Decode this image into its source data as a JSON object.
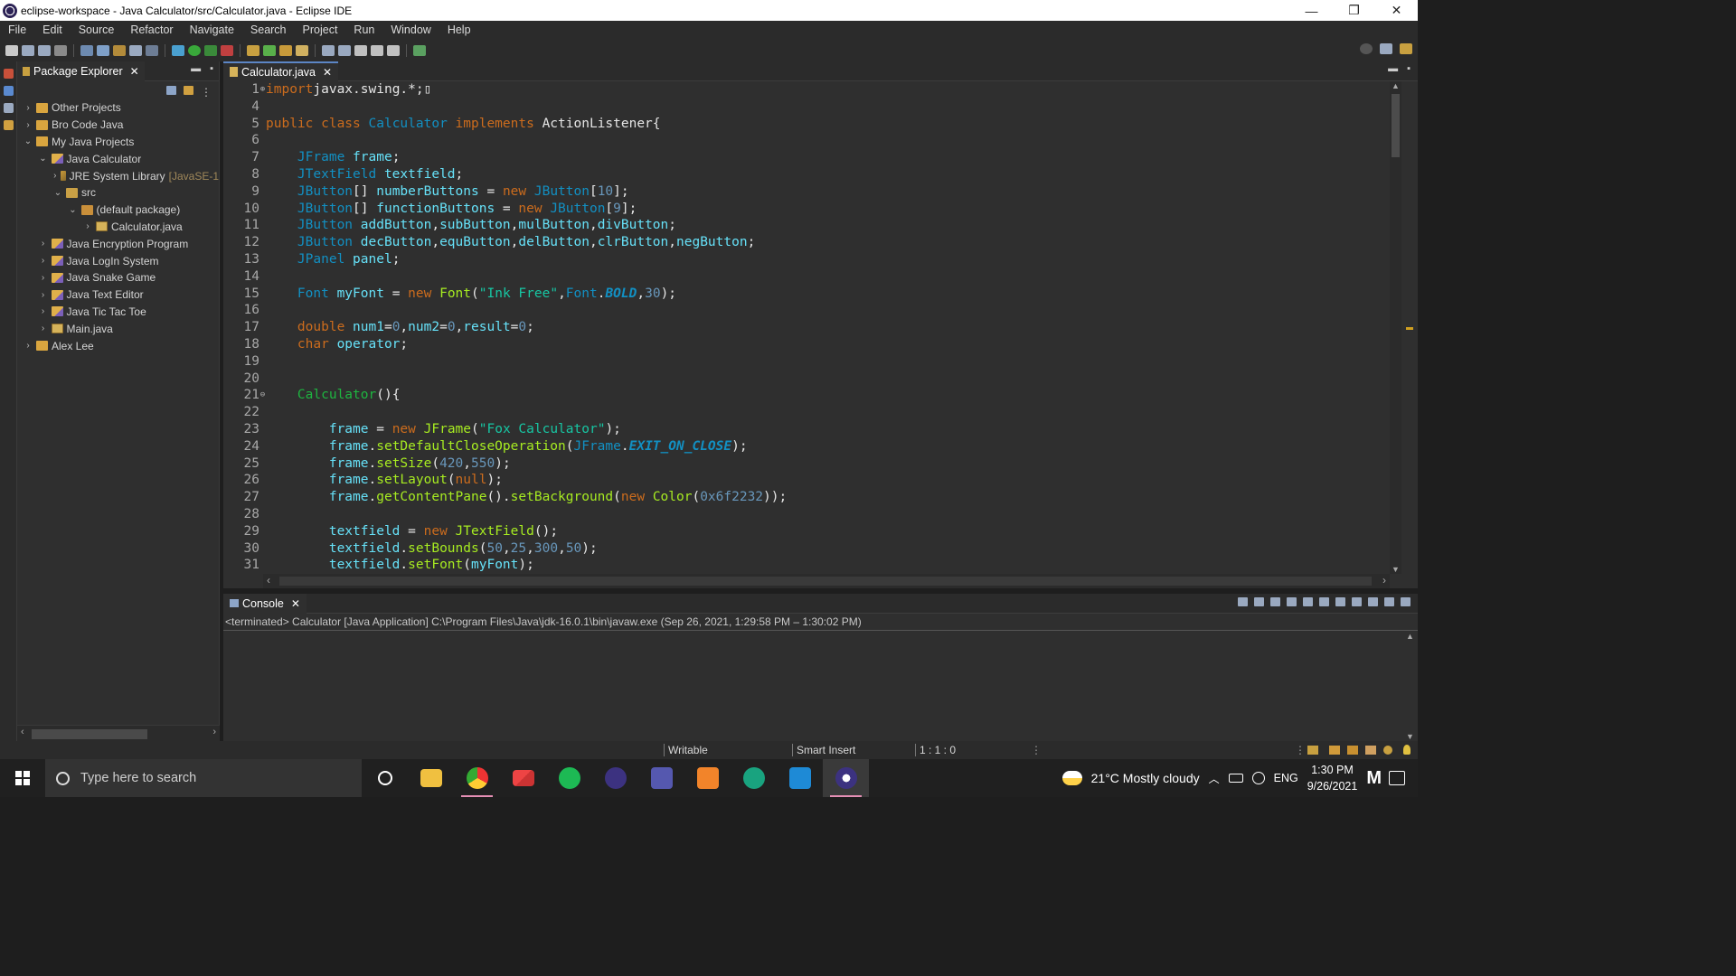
{
  "window": {
    "title": "eclipse-workspace - Java Calculator/src/Calculator.java - Eclipse IDE",
    "controls": [
      "—",
      "❐",
      "✕"
    ]
  },
  "menu": [
    "File",
    "Edit",
    "Source",
    "Refactor",
    "Navigate",
    "Search",
    "Project",
    "Run",
    "Window",
    "Help"
  ],
  "package_explorer": {
    "tab_label": "Package Explorer",
    "tree": [
      {
        "label": "Other Projects",
        "depth": 0,
        "twisty": ">",
        "icon": "folder-icon",
        "decoration": ""
      },
      {
        "label": "Bro Code Java",
        "depth": 0,
        "twisty": ">",
        "icon": "folder-icon",
        "decoration": ""
      },
      {
        "label": "My Java Projects",
        "depth": 0,
        "twisty": "v",
        "icon": "folder-icon",
        "decoration": ""
      },
      {
        "label": "Java Calculator",
        "depth": 1,
        "twisty": "v",
        "icon": "project-icon",
        "decoration": ""
      },
      {
        "label": "JRE System Library",
        "depth": 2,
        "twisty": ">",
        "icon": "library-icon",
        "decoration": "[JavaSE-1"
      },
      {
        "label": "src",
        "depth": 2,
        "twisty": "v",
        "icon": "source-folder-icon",
        "decoration": ""
      },
      {
        "label": "(default package)",
        "depth": 3,
        "twisty": "v",
        "icon": "package-icon",
        "decoration": ""
      },
      {
        "label": "Calculator.java",
        "depth": 4,
        "twisty": ">",
        "icon": "java-file-icon",
        "decoration": ""
      },
      {
        "label": "Java Encryption Program",
        "depth": 1,
        "twisty": ">",
        "icon": "project-icon",
        "decoration": ""
      },
      {
        "label": "Java LogIn System",
        "depth": 1,
        "twisty": ">",
        "icon": "project-icon",
        "decoration": ""
      },
      {
        "label": "Java Snake Game",
        "depth": 1,
        "twisty": ">",
        "icon": "project-icon",
        "decoration": ""
      },
      {
        "label": "Java Text Editor",
        "depth": 1,
        "twisty": ">",
        "icon": "project-icon",
        "decoration": ""
      },
      {
        "label": "Java Tic Tac Toe",
        "depth": 1,
        "twisty": ">",
        "icon": "project-icon",
        "decoration": ""
      },
      {
        "label": "Main.java",
        "depth": 1,
        "twisty": ">",
        "icon": "java-file-icon",
        "decoration": ""
      },
      {
        "label": "Alex Lee",
        "depth": 0,
        "twisty": ">",
        "icon": "folder-icon",
        "decoration": ""
      }
    ]
  },
  "editor": {
    "tab_label": "Calculator.java",
    "lines": [
      {
        "n": "1",
        "fold": "⊕",
        "tokens": [
          [
            "kw",
            "import"
          ],
          [
            "",
            "javax.swing.*;"
          ],
          [
            "",
            "▯"
          ]
        ]
      },
      {
        "n": "4",
        "fold": "",
        "tokens": []
      },
      {
        "n": "5",
        "fold": "",
        "tokens": [
          [
            "kw",
            "public class "
          ],
          [
            "ty",
            "Calculator "
          ],
          [
            "kw",
            "implements "
          ],
          [
            "",
            "ActionListener{"
          ]
        ]
      },
      {
        "n": "6",
        "fold": "",
        "tokens": []
      },
      {
        "n": "7",
        "fold": "",
        "tokens": [
          [
            "",
            "    "
          ],
          [
            "ty",
            "JFrame "
          ],
          [
            "vf",
            "frame"
          ],
          [
            "",
            ";"
          ]
        ]
      },
      {
        "n": "8",
        "fold": "",
        "tokens": [
          [
            "",
            "    "
          ],
          [
            "ty",
            "JTextField "
          ],
          [
            "vf",
            "textfield"
          ],
          [
            "",
            ";"
          ]
        ]
      },
      {
        "n": "9",
        "fold": "",
        "tokens": [
          [
            "",
            "    "
          ],
          [
            "ty",
            "JButton"
          ],
          [
            "",
            "[] "
          ],
          [
            "vf",
            "numberButtons"
          ],
          [
            "",
            " = "
          ],
          [
            "kw",
            "new "
          ],
          [
            "ty",
            "JButton"
          ],
          [
            "",
            "["
          ],
          [
            "nu",
            "10"
          ],
          [
            "",
            "];"
          ]
        ]
      },
      {
        "n": "10",
        "fold": "",
        "tokens": [
          [
            "",
            "    "
          ],
          [
            "ty",
            "JButton"
          ],
          [
            "",
            "[] "
          ],
          [
            "vf",
            "functionButtons"
          ],
          [
            "",
            " = "
          ],
          [
            "kw",
            "new "
          ],
          [
            "ty",
            "JButton"
          ],
          [
            "",
            "["
          ],
          [
            "nu",
            "9"
          ],
          [
            "",
            "];"
          ]
        ]
      },
      {
        "n": "11",
        "fold": "",
        "tokens": [
          [
            "",
            "    "
          ],
          [
            "ty",
            "JButton "
          ],
          [
            "vf",
            "addButton"
          ],
          [
            "",
            ","
          ],
          [
            "vf",
            "subButton"
          ],
          [
            "",
            ","
          ],
          [
            "vf",
            "mulButton"
          ],
          [
            "",
            ","
          ],
          [
            "vf",
            "divButton"
          ],
          [
            "",
            ";"
          ]
        ]
      },
      {
        "n": "12",
        "fold": "",
        "tokens": [
          [
            "",
            "    "
          ],
          [
            "ty",
            "JButton "
          ],
          [
            "vf",
            "decButton"
          ],
          [
            "",
            ","
          ],
          [
            "vf",
            "equButton"
          ],
          [
            "",
            ","
          ],
          [
            "vf",
            "delButton"
          ],
          [
            "",
            ","
          ],
          [
            "vf",
            "clrButton"
          ],
          [
            "",
            ","
          ],
          [
            "vf",
            "negButton"
          ],
          [
            "",
            ";"
          ]
        ]
      },
      {
        "n": "13",
        "fold": "",
        "tokens": [
          [
            "",
            "    "
          ],
          [
            "ty",
            "JPanel "
          ],
          [
            "vf",
            "panel"
          ],
          [
            "",
            ";"
          ]
        ]
      },
      {
        "n": "14",
        "fold": "",
        "tokens": []
      },
      {
        "n": "15",
        "fold": "",
        "tokens": [
          [
            "",
            "    "
          ],
          [
            "ty",
            "Font "
          ],
          [
            "vf",
            "myFont"
          ],
          [
            "",
            " = "
          ],
          [
            "kw",
            "new "
          ],
          [
            "mt",
            "Font"
          ],
          [
            "",
            "("
          ],
          [
            "st",
            "\"Ink Free\""
          ],
          [
            "",
            ","
          ],
          [
            "ty",
            "Font"
          ],
          [
            "",
            "."
          ],
          [
            "co",
            "BOLD"
          ],
          [
            "",
            ","
          ],
          [
            "nu",
            "30"
          ],
          [
            "",
            ");"
          ]
        ]
      },
      {
        "n": "16",
        "fold": "",
        "tokens": []
      },
      {
        "n": "17",
        "fold": "",
        "tokens": [
          [
            "",
            "    "
          ],
          [
            "kw",
            "double "
          ],
          [
            "vf",
            "num1"
          ],
          [
            "",
            "="
          ],
          [
            "nu",
            "0"
          ],
          [
            "",
            ","
          ],
          [
            "vf",
            "num2"
          ],
          [
            "",
            "="
          ],
          [
            "nu",
            "0"
          ],
          [
            "",
            ","
          ],
          [
            "vf",
            "result"
          ],
          [
            "",
            "="
          ],
          [
            "nu",
            "0"
          ],
          [
            "",
            ";"
          ]
        ]
      },
      {
        "n": "18",
        "fold": "",
        "tokens": [
          [
            "",
            "    "
          ],
          [
            "kw",
            "char "
          ],
          [
            "vf",
            "operator"
          ],
          [
            "",
            ";"
          ]
        ]
      },
      {
        "n": "19",
        "fold": "",
        "tokens": []
      },
      {
        "n": "20",
        "fold": "",
        "tokens": []
      },
      {
        "n": "21",
        "fold": "⊖",
        "tokens": [
          [
            "",
            "    "
          ],
          [
            "cl",
            "Calculator"
          ],
          [
            "",
            "(){"
          ]
        ]
      },
      {
        "n": "22",
        "fold": "",
        "tokens": []
      },
      {
        "n": "23",
        "fold": "",
        "tokens": [
          [
            "",
            "        "
          ],
          [
            "vf",
            "frame"
          ],
          [
            "",
            " = "
          ],
          [
            "kw",
            "new "
          ],
          [
            "mt",
            "JFrame"
          ],
          [
            "",
            "("
          ],
          [
            "st",
            "\"Fox Calculator\""
          ],
          [
            "",
            ");"
          ]
        ]
      },
      {
        "n": "24",
        "fold": "",
        "tokens": [
          [
            "",
            "        "
          ],
          [
            "vf",
            "frame"
          ],
          [
            "",
            "."
          ],
          [
            "mt",
            "setDefaultCloseOperation"
          ],
          [
            "",
            "("
          ],
          [
            "ty",
            "JFrame"
          ],
          [
            "",
            "."
          ],
          [
            "co",
            "EXIT_ON_CLOSE"
          ],
          [
            "",
            ");"
          ]
        ]
      },
      {
        "n": "25",
        "fold": "",
        "tokens": [
          [
            "",
            "        "
          ],
          [
            "vf",
            "frame"
          ],
          [
            "",
            "."
          ],
          [
            "mt",
            "setSize"
          ],
          [
            "",
            "("
          ],
          [
            "nu",
            "420"
          ],
          [
            "",
            ","
          ],
          [
            "nu",
            "550"
          ],
          [
            "",
            ");"
          ]
        ]
      },
      {
        "n": "26",
        "fold": "",
        "tokens": [
          [
            "",
            "        "
          ],
          [
            "vf",
            "frame"
          ],
          [
            "",
            "."
          ],
          [
            "mt",
            "setLayout"
          ],
          [
            "",
            "("
          ],
          [
            "kw",
            "null"
          ],
          [
            "",
            ");"
          ]
        ]
      },
      {
        "n": "27",
        "fold": "",
        "tokens": [
          [
            "",
            "        "
          ],
          [
            "vf",
            "frame"
          ],
          [
            "",
            "."
          ],
          [
            "mt",
            "getContentPane"
          ],
          [
            "",
            "()."
          ],
          [
            "mt",
            "setBackground"
          ],
          [
            "",
            "("
          ],
          [
            "kw",
            "new "
          ],
          [
            "mt",
            "Color"
          ],
          [
            "",
            "("
          ],
          [
            "nu",
            "0x6f2232"
          ],
          [
            "",
            "));"
          ]
        ]
      },
      {
        "n": "28",
        "fold": "",
        "tokens": []
      },
      {
        "n": "29",
        "fold": "",
        "tokens": [
          [
            "",
            "        "
          ],
          [
            "vf",
            "textfield"
          ],
          [
            "",
            " = "
          ],
          [
            "kw",
            "new "
          ],
          [
            "mt",
            "JTextField"
          ],
          [
            "",
            "();"
          ]
        ]
      },
      {
        "n": "30",
        "fold": "",
        "tokens": [
          [
            "",
            "        "
          ],
          [
            "vf",
            "textfield"
          ],
          [
            "",
            "."
          ],
          [
            "mt",
            "setBounds"
          ],
          [
            "",
            "("
          ],
          [
            "nu",
            "50"
          ],
          [
            "",
            ","
          ],
          [
            "nu",
            "25"
          ],
          [
            "",
            ","
          ],
          [
            "nu",
            "300"
          ],
          [
            "",
            ","
          ],
          [
            "nu",
            "50"
          ],
          [
            "",
            ");"
          ]
        ]
      },
      {
        "n": "31",
        "fold": "",
        "tokens": [
          [
            "",
            "        "
          ],
          [
            "vf",
            "textfield"
          ],
          [
            "",
            "."
          ],
          [
            "mt",
            "setFont"
          ],
          [
            "",
            "("
          ],
          [
            "vf",
            "myFont"
          ],
          [
            "",
            ");"
          ]
        ]
      }
    ]
  },
  "console": {
    "tab_label": "Console",
    "status": "<terminated> Calculator [Java Application] C:\\Program Files\\Java\\jdk-16.0.1\\bin\\javaw.exe  (Sep 26, 2021, 1:29:58 PM – 1:30:02 PM)"
  },
  "statusbar": {
    "mode": "Writable",
    "insert": "Smart Insert",
    "position": "1 : 1 : 0"
  },
  "taskbar": {
    "search_placeholder": "Type here to search",
    "weather": "21°C  Mostly cloudy",
    "language": "ENG",
    "time": "1:30 PM",
    "date": "9/26/2021",
    "apps": [
      "cortana-icon",
      "file-explorer-icon",
      "chrome-icon",
      "gmail-icon",
      "spotify-icon",
      "eclipse-icon",
      "teams-icon",
      "sublime-icon",
      "chatgpt-icon",
      "vscode-icon",
      "eclipse-running-icon"
    ]
  },
  "colors": {
    "keyword": "#cc6c1d",
    "type": "#1290c3",
    "field": "#66e1f8",
    "method": "#a7ec21",
    "string": "#17c6a3",
    "number": "#6897bb"
  }
}
